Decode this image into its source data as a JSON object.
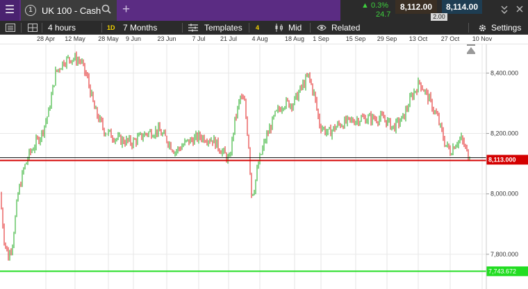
{
  "topbar": {
    "menu_icon": "hamburger-icon",
    "instrument_number": "1",
    "instrument_name": "UK 100 - Cash",
    "search_icon": "search-icon",
    "add_tab_icon": "plus-icon",
    "change_pct": "▲ 0.3%",
    "change_pts": "24.7",
    "sell_price": "8,112.00",
    "buy_price": "8,114.00",
    "spread": "2.00",
    "window_icons": [
      "collapse-icon",
      "close-icon"
    ]
  },
  "toolbar": {
    "interval": "4 hours",
    "interval_badge": "1D",
    "range": "7 Months",
    "templates": "Templates",
    "templates_badge": "4",
    "price_mode": "Mid",
    "related": "Related",
    "settings": "Settings"
  },
  "date_labels": [
    "28 Apr",
    "12 May",
    "28 May",
    "9 Jun",
    "23 Jun",
    "7 Jul",
    "21 Jul",
    "4 Aug",
    "18 Aug",
    "1 Sep",
    "15 Sep",
    "29 Sep",
    "13 Oct",
    "27 Oct",
    "10 Nov"
  ],
  "colors": {
    "up": "#18a818",
    "down": "#e01a1a",
    "accent": "#5b2c83",
    "current_price_bg": "#d40000",
    "alert_line": "#22dd22"
  },
  "chart_data": {
    "type": "candlestick",
    "instrument": "UK 100 - Cash",
    "y_ticks": [
      "8,400.000",
      "8,200.000",
      "8,000.000",
      "7,800.000"
    ],
    "y_tick_values": [
      8400,
      8200,
      8000,
      7800
    ],
    "ylim": [
      7685,
      8495
    ],
    "current_price_label": "8,113.000",
    "current_price": 8113,
    "alert_label": "7,743.672",
    "alert_price": 7743.672,
    "grid": true,
    "trend_approx": [
      [
        0,
        8000
      ],
      [
        6,
        7850
      ],
      [
        12,
        7790
      ],
      [
        18,
        7840
      ],
      [
        26,
        8000
      ],
      [
        34,
        8080
      ],
      [
        42,
        8130
      ],
      [
        52,
        8170
      ],
      [
        60,
        8200
      ],
      [
        70,
        8270
      ],
      [
        80,
        8400
      ],
      [
        92,
        8440
      ],
      [
        104,
        8450
      ],
      [
        116,
        8440
      ],
      [
        126,
        8380
      ],
      [
        136,
        8280
      ],
      [
        150,
        8210
      ],
      [
        170,
        8180
      ],
      [
        190,
        8170
      ],
      [
        210,
        8200
      ],
      [
        228,
        8210
      ],
      [
        240,
        8180
      ],
      [
        252,
        8140
      ],
      [
        268,
        8170
      ],
      [
        288,
        8190
      ],
      [
        306,
        8180
      ],
      [
        320,
        8140
      ],
      [
        330,
        8110
      ],
      [
        338,
        8240
      ],
      [
        346,
        8320
      ],
      [
        352,
        8300
      ],
      [
        358,
        8160
      ],
      [
        362,
        8000
      ],
      [
        366,
        8020
      ],
      [
        372,
        8100
      ],
      [
        382,
        8180
      ],
      [
        396,
        8260
      ],
      [
        408,
        8300
      ],
      [
        422,
        8300
      ],
      [
        436,
        8360
      ],
      [
        444,
        8390
      ],
      [
        452,
        8330
      ],
      [
        460,
        8230
      ],
      [
        472,
        8200
      ],
      [
        488,
        8230
      ],
      [
        504,
        8240
      ],
      [
        520,
        8250
      ],
      [
        536,
        8250
      ],
      [
        552,
        8250
      ],
      [
        566,
        8220
      ],
      [
        580,
        8250
      ],
      [
        592,
        8320
      ],
      [
        604,
        8370
      ],
      [
        616,
        8320
      ],
      [
        630,
        8250
      ],
      [
        640,
        8170
      ],
      [
        648,
        8140
      ],
      [
        656,
        8170
      ],
      [
        664,
        8180
      ],
      [
        670,
        8150
      ],
      [
        676,
        8113
      ]
    ]
  }
}
